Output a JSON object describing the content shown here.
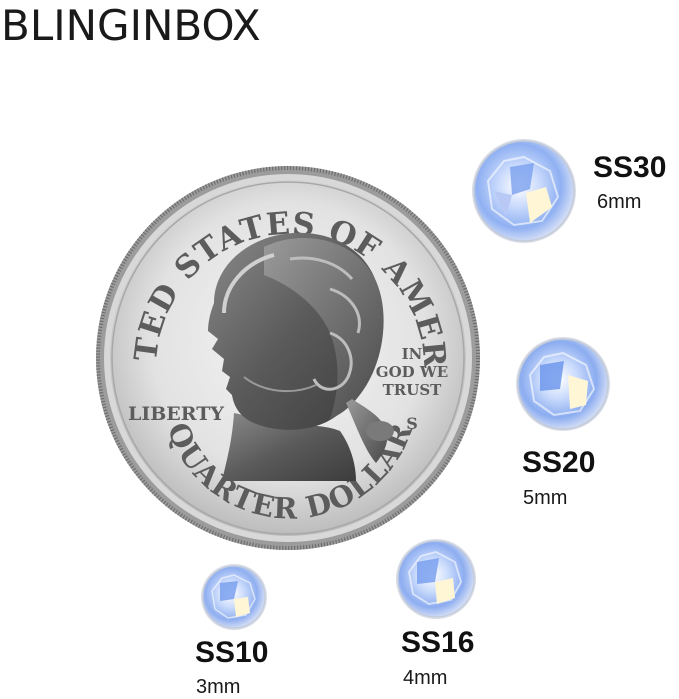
{
  "brand": {
    "name": "BLINGINBOX"
  },
  "coin": {
    "top_text": "UNITED STATES OF AMERICA",
    "bottom_text": "QUARTER DOLLAR",
    "motto_line1": "IN",
    "motto_line2": "GOD WE",
    "motto_line3": "TRUST",
    "liberty": "LIBERTY",
    "mint_mark": "S"
  },
  "gems": [
    {
      "code": "SS30",
      "size": "6mm"
    },
    {
      "code": "SS20",
      "size": "5mm"
    },
    {
      "code": "SS16",
      "size": "4mm"
    },
    {
      "code": "SS10",
      "size": "3mm"
    }
  ],
  "colors": {
    "text": "#111111",
    "coin_silver": "#c9c9c9",
    "gem_blue": "#7aa8f0",
    "gem_highlight": "#fff6d6"
  }
}
